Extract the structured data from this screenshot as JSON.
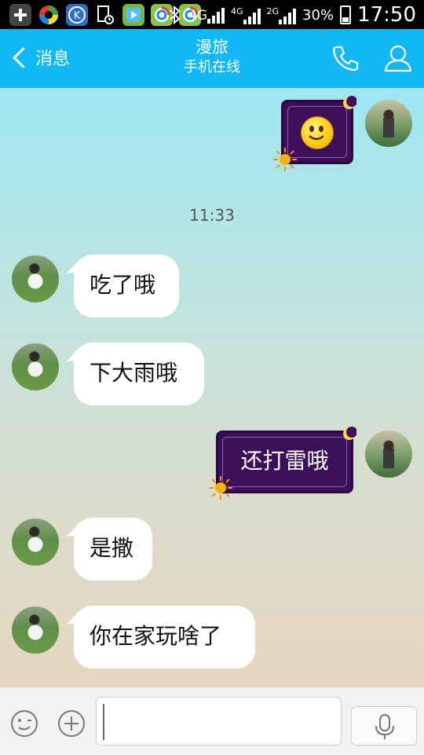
{
  "status_bar": {
    "network_label": "4G",
    "signal1_label": "4G",
    "signal2_label": "2G",
    "battery_percent": "30%",
    "battery_level": 0.3,
    "time": "17:50",
    "app_icons": [
      "add-icon",
      "color-wheel-icon",
      "k-app-icon",
      "file-clock-icon",
      "play-icon",
      "browser-icon",
      "browser-icon-2",
      "bluetooth-icon"
    ]
  },
  "header": {
    "back_label": "消息",
    "contact_name": "漫旅",
    "contact_status": "手机在线",
    "call_icon": "phone-icon",
    "profile_icon": "person-icon",
    "color": "#12b7f5"
  },
  "chat": {
    "timestamp": "11:33",
    "messages": [
      {
        "dir": "out",
        "type": "emoji",
        "emoji": "smiley-face"
      },
      {
        "dir": "in",
        "text": "吃了哦"
      },
      {
        "dir": "in",
        "text": "下大雨哦"
      },
      {
        "dir": "out",
        "text": "还打雷哦"
      },
      {
        "dir": "in",
        "text": "是撒"
      },
      {
        "dir": "in",
        "text": "你在家玩啥了"
      }
    ]
  },
  "input_bar": {
    "emoji_icon": "smiley-icon",
    "plus_icon": "plus-icon",
    "text_value": "",
    "voice_icon": "microphone-icon"
  }
}
